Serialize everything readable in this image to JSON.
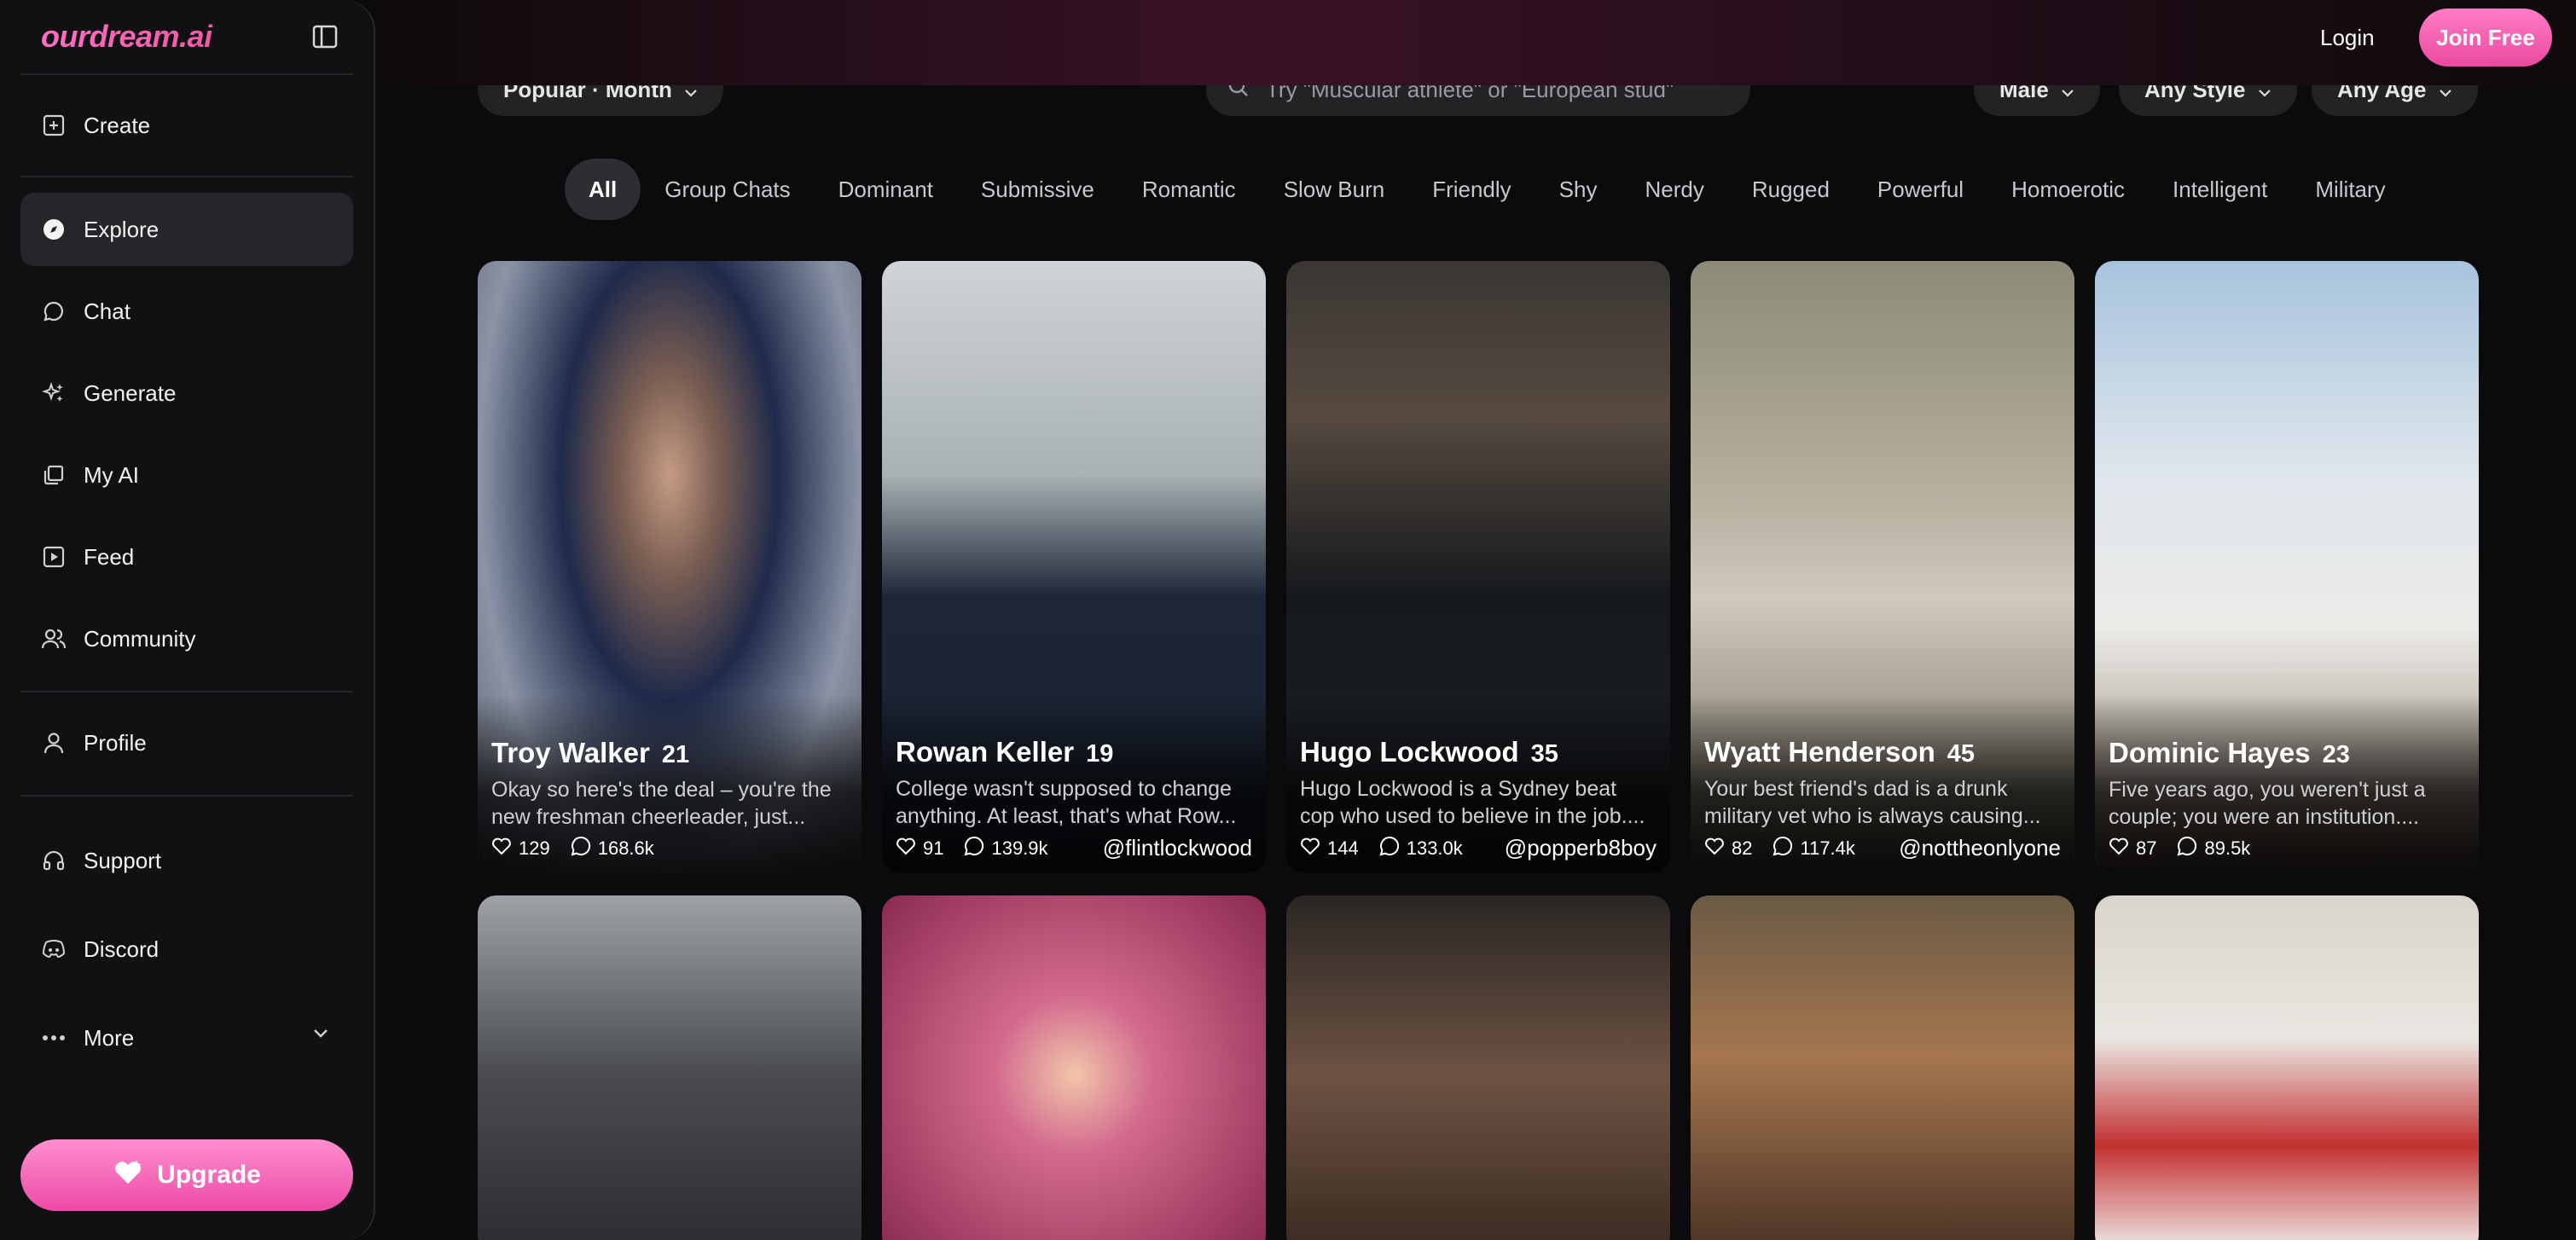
{
  "brand": {
    "logo": "ourdream.ai"
  },
  "sidebar": {
    "items": [
      {
        "label": "Create",
        "icon": "plus-square-icon"
      },
      {
        "label": "Explore",
        "icon": "compass-icon"
      },
      {
        "label": "Chat",
        "icon": "chat-bubble-icon"
      },
      {
        "label": "Generate",
        "icon": "sparkles-icon"
      },
      {
        "label": "My AI",
        "icon": "stack-icon"
      },
      {
        "label": "Feed",
        "icon": "play-square-icon"
      },
      {
        "label": "Community",
        "icon": "users-icon"
      },
      {
        "label": "Profile",
        "icon": "user-icon"
      },
      {
        "label": "Support",
        "icon": "headset-icon"
      },
      {
        "label": "Discord",
        "icon": "discord-icon"
      },
      {
        "label": "More",
        "icon": "more-dots-icon"
      }
    ],
    "active": "Explore",
    "upgrade_label": "Upgrade"
  },
  "header": {
    "login_label": "Login",
    "join_label": "Join Free"
  },
  "filters": {
    "sort": "Popular · Month",
    "search_placeholder": "Try \"Muscular athlete\" or \"European stud\"",
    "gender": "Male",
    "style": "Any Style",
    "age": "Any Age"
  },
  "tags": [
    "All",
    "Group Chats",
    "Dominant",
    "Submissive",
    "Romantic",
    "Slow Burn",
    "Friendly",
    "Shy",
    "Nerdy",
    "Rugged",
    "Powerful",
    "Homoerotic",
    "Intelligent",
    "Military"
  ],
  "active_tag": "All",
  "cards": [
    {
      "name": "Troy Walker",
      "age": "21",
      "desc": "Okay so here's the deal – you're the new freshman cheerleader, just...",
      "likes": "129",
      "comments": "168.6k",
      "handle": ""
    },
    {
      "name": "Rowan Keller",
      "age": "19",
      "desc": "College wasn't supposed to change anything. At least, that's what Row...",
      "likes": "91",
      "comments": "139.9k",
      "handle": "@flintlockwood"
    },
    {
      "name": "Hugo Lockwood",
      "age": "35",
      "desc": "Hugo Lockwood is a Sydney beat cop who used to believe in the job....",
      "likes": "144",
      "comments": "133.0k",
      "handle": "@popperb8boy"
    },
    {
      "name": "Wyatt Henderson",
      "age": "45",
      "desc": "Your best friend's dad is a drunk military vet who is always causing...",
      "likes": "82",
      "comments": "117.4k",
      "handle": "@nottheonlyone"
    },
    {
      "name": "Dominic Hayes",
      "age": "23",
      "desc": "Five years ago, you weren't just a couple; you were an institution....",
      "likes": "87",
      "comments": "89.5k",
      "handle": ""
    }
  ],
  "colors": {
    "accent": "#ec4aa5",
    "accent_light": "#ff8fd0",
    "sidebar_bg": "#111113",
    "page_bg": "#0b0b0d"
  }
}
